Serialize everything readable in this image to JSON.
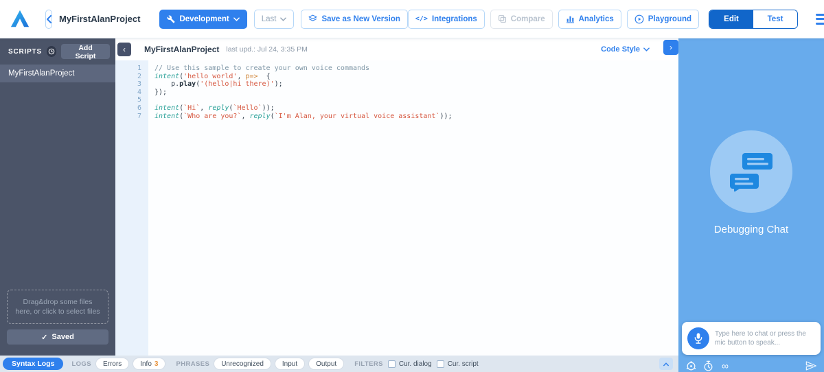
{
  "colors": {
    "accent": "#2f80ed",
    "accent_dark": "#1166ca",
    "sidebar_bg": "#4b5468",
    "sidebar_selected": "#5d677e",
    "sidebar_button": "#606b82",
    "gutter_bg": "#e9f2fc",
    "gutter_text": "#84a8c9",
    "right_panel_bg": "#68abec",
    "right_circle_bg": "#9dcaf4",
    "bottombar_bg": "#dee6ef",
    "syntax_comment": "#7d95a5",
    "syntax_keyword": "#2aa198",
    "syntax_string": "#d6573f",
    "syntax_param": "#cf8437"
  },
  "topbar": {
    "project_title": "MyFirstAlanProject",
    "env_button_label": "Development",
    "version_select_value": "Last",
    "save_version_label": "Save as New Version",
    "integrations_glyph": "</>",
    "integrations_label": "Integrations",
    "compare_label": "Compare",
    "analytics_label": "Analytics",
    "playground_label": "Playground",
    "edit_label": "Edit",
    "test_label": "Test"
  },
  "sidebar": {
    "header_label": "SCRIPTS",
    "add_script_label": "Add Script",
    "scripts": [
      {
        "name": "MyFirstAlanProject"
      }
    ],
    "dropzone_text": "Drag&drop some files here, or click to select files",
    "saved_check": "✓",
    "saved_label": "Saved"
  },
  "editor": {
    "collapse_glyph": "‹",
    "expand_glyph": "›",
    "title": "MyFirstAlanProject",
    "last_updated": "last upd.: Jul 24, 3:35 PM",
    "code_style_label": "Code Style"
  },
  "code": {
    "lines": [
      {
        "num": 1,
        "segments": [
          {
            "t": "// Use this sample to create your own voice commands",
            "c": "comment"
          }
        ]
      },
      {
        "num": 2,
        "segments": [
          {
            "t": "intent",
            "c": "keyword"
          },
          {
            "t": "(",
            "c": "plain"
          },
          {
            "t": "'hello world'",
            "c": "string"
          },
          {
            "t": ", ",
            "c": "plain"
          },
          {
            "t": "p=>",
            "c": "param"
          },
          {
            "t": "  {",
            "c": "plain"
          }
        ]
      },
      {
        "num": 3,
        "segments": [
          {
            "t": "    p.",
            "c": "plain"
          },
          {
            "t": "play",
            "c": "method"
          },
          {
            "t": "(",
            "c": "plain"
          },
          {
            "t": "'(hello|hi there)'",
            "c": "string"
          },
          {
            "t": ");",
            "c": "plain"
          }
        ]
      },
      {
        "num": 4,
        "segments": [
          {
            "t": "});",
            "c": "plain"
          }
        ]
      },
      {
        "num": 5,
        "segments": []
      },
      {
        "num": 6,
        "segments": [
          {
            "t": "intent",
            "c": "keyword"
          },
          {
            "t": "(",
            "c": "plain"
          },
          {
            "t": "`Hi`",
            "c": "string"
          },
          {
            "t": ", ",
            "c": "plain"
          },
          {
            "t": "reply",
            "c": "keyword"
          },
          {
            "t": "(",
            "c": "plain"
          },
          {
            "t": "`Hello`",
            "c": "string"
          },
          {
            "t": "));",
            "c": "plain"
          }
        ]
      },
      {
        "num": 7,
        "segments": [
          {
            "t": "intent",
            "c": "keyword"
          },
          {
            "t": "(",
            "c": "plain"
          },
          {
            "t": "`Who are you?`",
            "c": "string"
          },
          {
            "t": ", ",
            "c": "plain"
          },
          {
            "t": "reply",
            "c": "keyword"
          },
          {
            "t": "(",
            "c": "plain"
          },
          {
            "t": "`I'm Alan, your virtual voice assistant`",
            "c": "string"
          },
          {
            "t": "));",
            "c": "plain"
          }
        ]
      }
    ]
  },
  "right_panel": {
    "title": "Debugging Chat",
    "input_placeholder": "Type here to chat or press the mic button to speak..."
  },
  "bottombar": {
    "syntax_logs_label": "Syntax Logs",
    "logs_label": "LOGS",
    "errors_label": "Errors",
    "info_label": "Info",
    "info_count": "3",
    "phrases_label": "PHRASES",
    "unrecognized_label": "Unrecognized",
    "input_label": "Input",
    "output_label": "Output",
    "filters_label": "FILTERS",
    "cur_dialog_label": "Cur. dialog",
    "cur_script_label": "Cur. script"
  }
}
